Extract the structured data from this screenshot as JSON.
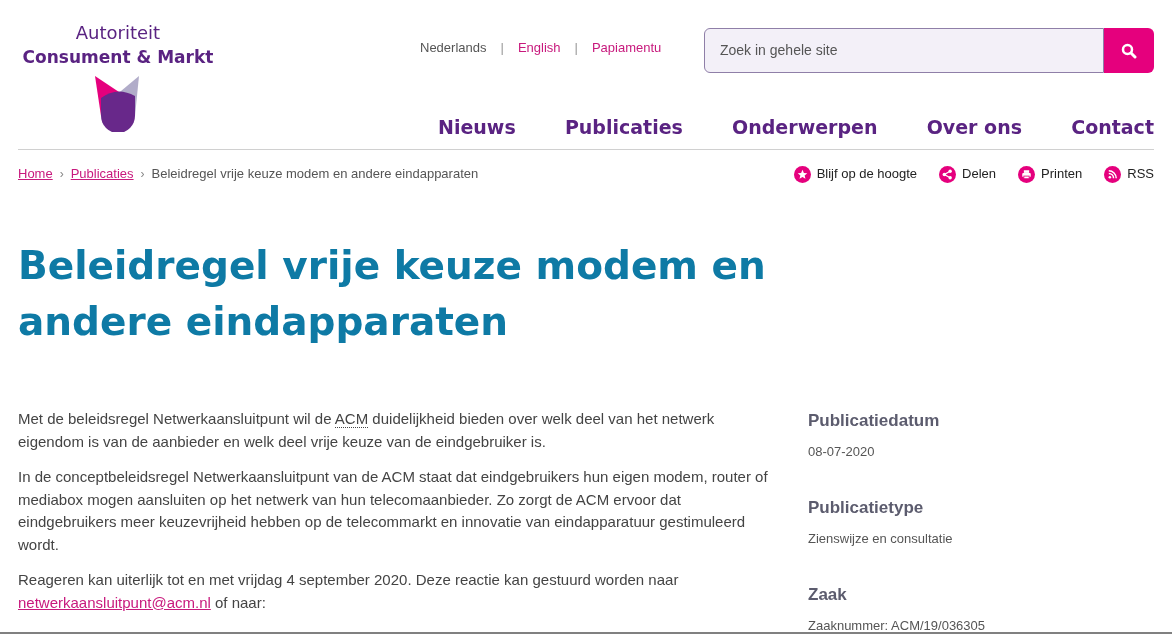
{
  "logo": {
    "line_1": "Autoriteit",
    "line_2": "Consument & Markt"
  },
  "languages": [
    {
      "label": "Nederlands",
      "selected": true
    },
    {
      "label": "English",
      "selected": false
    },
    {
      "label": "Papiamentu",
      "selected": false
    }
  ],
  "language_separator": "|",
  "search": {
    "placeholder": "Zoek in gehele site"
  },
  "nav": [
    "Nieuws",
    "Publicaties",
    "Onderwerpen",
    "Over ons",
    "Contact"
  ],
  "breadcrumb": [
    {
      "label": "Home",
      "kind": "link"
    },
    {
      "label": "Publicaties",
      "kind": "link"
    },
    {
      "label": "Beleidregel vrije keuze modem en andere eindapparaten",
      "kind": "current"
    }
  ],
  "breadcrumb_separator": "›",
  "actions": [
    {
      "label": "Blijf op de hoogte",
      "kind": "star"
    },
    {
      "label": "Delen",
      "kind": "share"
    },
    {
      "label": "Printen",
      "kind": "print"
    },
    {
      "label": "RSS",
      "kind": "rss"
    }
  ],
  "title": "Beleidregel vrije keuze modem en andere eindapparaten",
  "paragraphs": [
    [
      {
        "text": "Met de beleidsregel Netwerkaansluitpunt wil de ",
        "kind": "plain"
      },
      {
        "text": "ACM",
        "kind": "abbr"
      },
      {
        "text": " duidelijkheid bieden over welk deel van het netwerk eigendom is van de aanbieder en welk deel vrije keuze van de eindgebruiker is.",
        "kind": "plain"
      }
    ],
    [
      {
        "text": "In de conceptbeleidsregel Netwerkaansluitpunt van de ACM staat dat eindgebruikers hun eigen modem, router of mediabox mogen aansluiten op het netwerk van hun telecomaanbieder. Zo zorgt de ACM ervoor dat eindgebruikers meer keuzevrijheid hebben op de telecommarkt en innovatie van eindapparatuur gestimuleerd wordt.",
        "kind": "plain"
      }
    ],
    [
      {
        "text": "Reageren kan uiterlijk tot en met vrijdag 4 september 2020. Deze reactie kan gestuurd worden naar ",
        "kind": "plain"
      },
      {
        "text": "netwerkaansluitpunt@acm.nl",
        "kind": "link"
      },
      {
        "text": " of naar:",
        "kind": "plain"
      }
    ]
  ],
  "sidebar": [
    {
      "heading": "Publicatiedatum",
      "value": "08-07-2020"
    },
    {
      "heading": "Publicatietype",
      "value": "Zienswijze en consultatie"
    },
    {
      "heading": "Zaak",
      "value": "Zaaknummer: ACM/19/036305"
    }
  ]
}
